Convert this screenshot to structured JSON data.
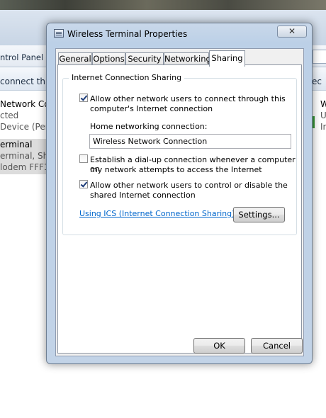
{
  "background": {
    "breadcrumb": "ntrol Panel",
    "task_left": "connect this",
    "task_right": "ec",
    "items": [
      {
        "line1": "Network Co",
        "line2": "cted",
        "line3": "Device (Perso"
      },
      {
        "line1": "erminal",
        "line2": "erminal, Shar",
        "line3": "lodem FFF1"
      }
    ],
    "right_col": [
      "W",
      "U",
      "In"
    ]
  },
  "dialog": {
    "title": "Wireless Terminal Properties",
    "close_glyph": "✕",
    "tabs": [
      {
        "label": "General"
      },
      {
        "label": "Options"
      },
      {
        "label": "Security"
      },
      {
        "label": "Networking"
      },
      {
        "label": "Sharing"
      }
    ],
    "active_tab": "Sharing",
    "ics_group": {
      "legend": "Internet Connection Sharing",
      "allow_connect": {
        "checked": true,
        "line1": "Allow other network users to connect through this",
        "line2": "computer's Internet connection"
      },
      "home_connection_label": "Home networking connection:",
      "home_connection_value": "Wireless Network Connection",
      "dialup": {
        "checked": false,
        "line1": "Establish a dial-up connection whenever a computer on",
        "line2": "my network attempts to access the Internet"
      },
      "allow_control": {
        "checked": true,
        "line1": "Allow other network users to control or disable the",
        "line2": "shared Internet connection"
      },
      "ics_link": "Using ICS (Internet Connection Sharing)",
      "settings_button": "Settings..."
    },
    "ok_button": "OK",
    "cancel_button": "Cancel"
  }
}
